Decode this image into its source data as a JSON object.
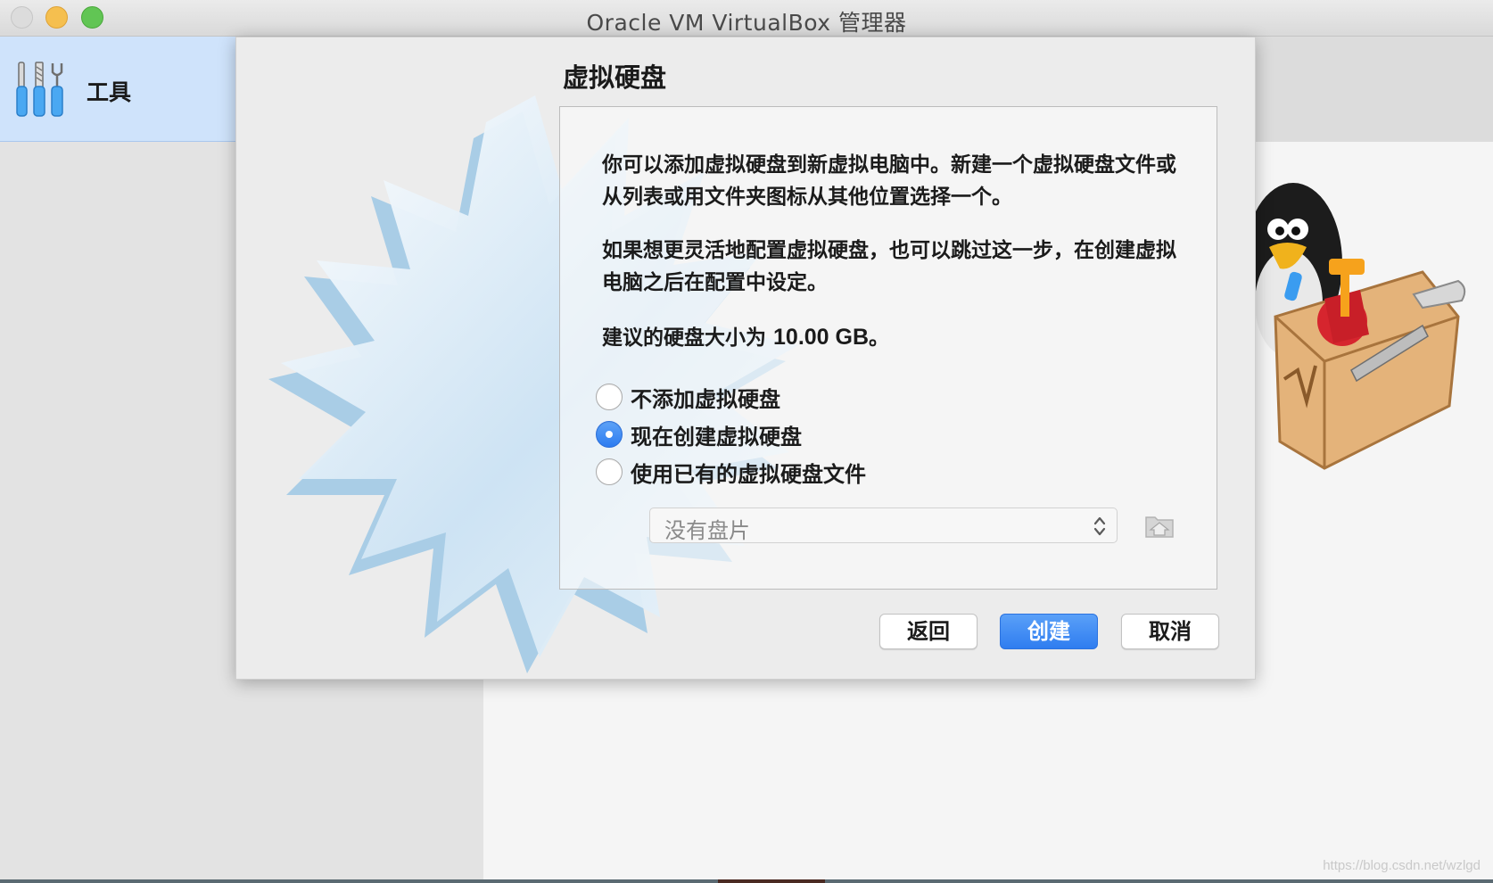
{
  "window": {
    "title": "Oracle VM VirtualBox 管理器"
  },
  "sidebar": {
    "tools_label": "工具",
    "tools_icon": "tools-icon"
  },
  "dialog": {
    "title": "虚拟硬盘",
    "paragraph1": "你可以添加虚拟硬盘到新虚拟电脑中。新建一个虚拟硬盘文件或从列表或用文件夹图标从其他位置选择一个。",
    "paragraph2": "如果想更灵活地配置虚拟硬盘，也可以跳过这一步，在创建虚拟电脑之后在配置中设定。",
    "recommend_prefix": "建议的硬盘大小为 ",
    "recommend_size": "10.00 GB",
    "recommend_suffix": "。",
    "options": [
      {
        "label": "不添加虚拟硬盘",
        "checked": false
      },
      {
        "label": "现在创建虚拟硬盘",
        "checked": true
      },
      {
        "label": "使用已有的虚拟硬盘文件",
        "checked": false
      }
    ],
    "disk_select": {
      "value": "没有盘片",
      "enabled": false
    },
    "folder_icon": "choose-disk-folder-icon",
    "buttons": {
      "back": "返回",
      "create": "创建",
      "cancel": "取消"
    }
  },
  "colors": {
    "accent_blue": "#2f7df0",
    "sidebar_selected": "#cfe3fb"
  },
  "watermark": "https://blog.csdn.net/wzlgd"
}
